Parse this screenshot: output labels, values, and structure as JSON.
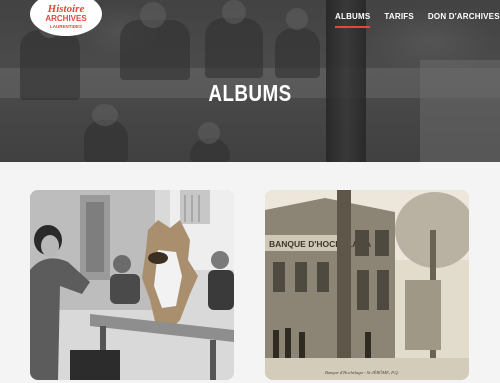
{
  "logo": {
    "line1": "Histoire",
    "line2": "ARCHIVES",
    "line3": "LAURENTIDES"
  },
  "nav": {
    "items": [
      {
        "label": "ALBUMS",
        "active": true
      },
      {
        "label": "TARIFS",
        "active": false
      },
      {
        "label": "DON D'ARCHIVES",
        "active": false
      }
    ]
  },
  "page": {
    "title": "ALBUMS"
  },
  "albums": [
    {
      "kind": "photo-woman-with-collie"
    },
    {
      "kind": "postcard-banque-hochelaga",
      "caption_sign": "BANQUE D'HOCHELAGA",
      "caption_bottom": "Banque d'Hochelaga - St-JÉRÔME, P.Q."
    }
  ],
  "colors": {
    "accent": "#e0483a",
    "hero_overlay": "#3a3a3a",
    "background": "#f4f4f4"
  }
}
